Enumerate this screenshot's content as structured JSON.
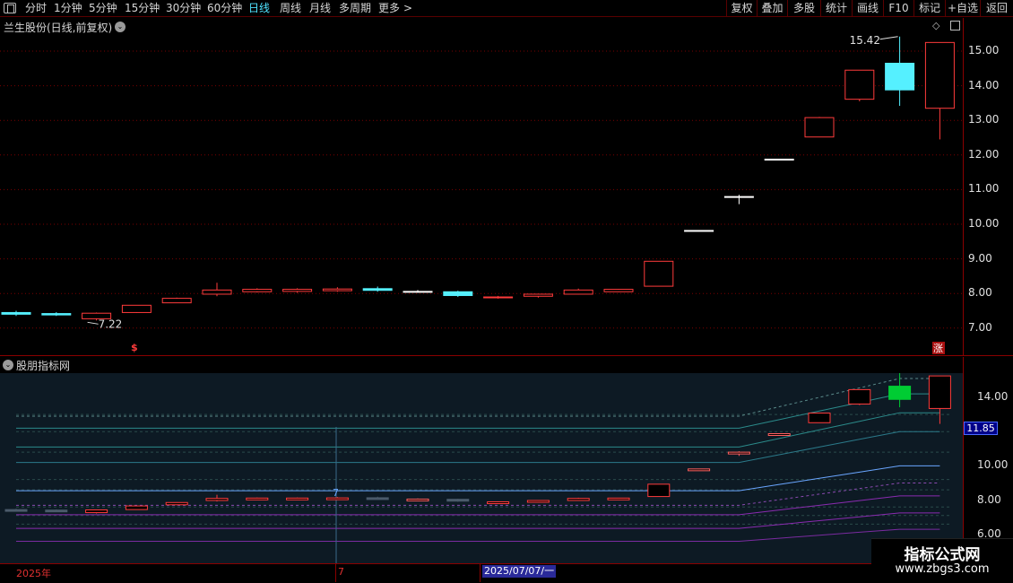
{
  "toolbar": {
    "periods": [
      "分时",
      "1分钟",
      "5分钟",
      "15分钟",
      "30分钟",
      "60分钟",
      "日线",
      "周线",
      "月线",
      "多周期",
      "更多"
    ],
    "active_period": "日线",
    "more_arrow": ">",
    "actions": [
      "复权",
      "叠加",
      "多股",
      "统计",
      "画线",
      "F10",
      "标记",
      "+自选",
      "返回"
    ]
  },
  "main_panel": {
    "title": "兰生股份(日线,前复权)",
    "y_ticks": [
      "15.00",
      "14.00",
      "13.00",
      "12.00",
      "11.00",
      "10.00",
      "9.00",
      "8.00",
      "7.00"
    ],
    "high_annotation": "15.42",
    "low_annotation": "7.22",
    "dividend_marker": "$",
    "limit_badge": "涨"
  },
  "sub_panel": {
    "title": "股朋指标网",
    "y_ticks": [
      "14.00",
      "10.00",
      "8.00",
      "6.00"
    ],
    "current_value": "11.85",
    "cursor_label": "7"
  },
  "x_axis": {
    "labels": [
      "2025年",
      "7"
    ],
    "selected_date": "2025/07/07/一"
  },
  "watermark": {
    "title": "指标公式网",
    "url": "www.zbgs3.com"
  },
  "colors": {
    "up": "#ff3b3b",
    "down_cyan": "#55f0ff",
    "down_green": "#00cc33",
    "grid": "#7a0000",
    "ma_blue": "#6aa6ff",
    "band_teal": "#2b8a8a",
    "band_purple": "#8a2bb0"
  },
  "chart_data": {
    "type": "candlestick",
    "y_range": [
      6.5,
      16.0
    ],
    "candles": [
      {
        "o": 7.45,
        "h": 7.5,
        "l": 7.35,
        "c": 7.4
      },
      {
        "o": 7.42,
        "h": 7.46,
        "l": 7.35,
        "c": 7.38
      },
      {
        "o": 7.27,
        "h": 7.45,
        "l": 7.22,
        "c": 7.43
      },
      {
        "o": 7.45,
        "h": 7.66,
        "l": 7.44,
        "c": 7.66
      },
      {
        "o": 7.73,
        "h": 7.88,
        "l": 7.72,
        "c": 7.86
      },
      {
        "o": 7.98,
        "h": 8.31,
        "l": 7.92,
        "c": 8.1
      },
      {
        "o": 8.05,
        "h": 8.15,
        "l": 8.03,
        "c": 8.12
      },
      {
        "o": 8.06,
        "h": 8.15,
        "l": 8.02,
        "c": 8.12
      },
      {
        "o": 8.08,
        "h": 8.18,
        "l": 8.05,
        "c": 8.13
      },
      {
        "o": 8.14,
        "h": 8.2,
        "l": 8.05,
        "c": 8.09
      },
      {
        "o": 8.06,
        "h": 8.1,
        "l": 8.02,
        "c": 8.06
      },
      {
        "o": 8.05,
        "h": 8.08,
        "l": 7.9,
        "c": 7.94
      },
      {
        "o": 7.88,
        "h": 7.93,
        "l": 7.85,
        "c": 7.9
      },
      {
        "o": 7.92,
        "h": 7.98,
        "l": 7.88,
        "c": 7.98
      },
      {
        "o": 7.98,
        "h": 8.14,
        "l": 7.97,
        "c": 8.1
      },
      {
        "o": 8.05,
        "h": 8.13,
        "l": 8.04,
        "c": 8.12
      },
      {
        "o": 8.21,
        "h": 8.93,
        "l": 8.21,
        "c": 8.93
      },
      {
        "o": 9.82,
        "h": 9.82,
        "l": 9.82,
        "c": 9.82
      },
      {
        "o": 10.8,
        "h": 10.85,
        "l": 10.58,
        "c": 10.8
      },
      {
        "o": 11.88,
        "h": 11.88,
        "l": 11.88,
        "c": 11.88
      },
      {
        "o": 12.52,
        "h": 13.1,
        "l": 12.52,
        "c": 13.08
      },
      {
        "o": 13.61,
        "h": 14.45,
        "l": 13.55,
        "c": 14.45
      },
      {
        "o": 14.65,
        "h": 15.42,
        "l": 13.42,
        "c": 13.88
      },
      {
        "o": 13.35,
        "h": 15.25,
        "l": 12.45,
        "c": 15.25
      }
    ]
  }
}
